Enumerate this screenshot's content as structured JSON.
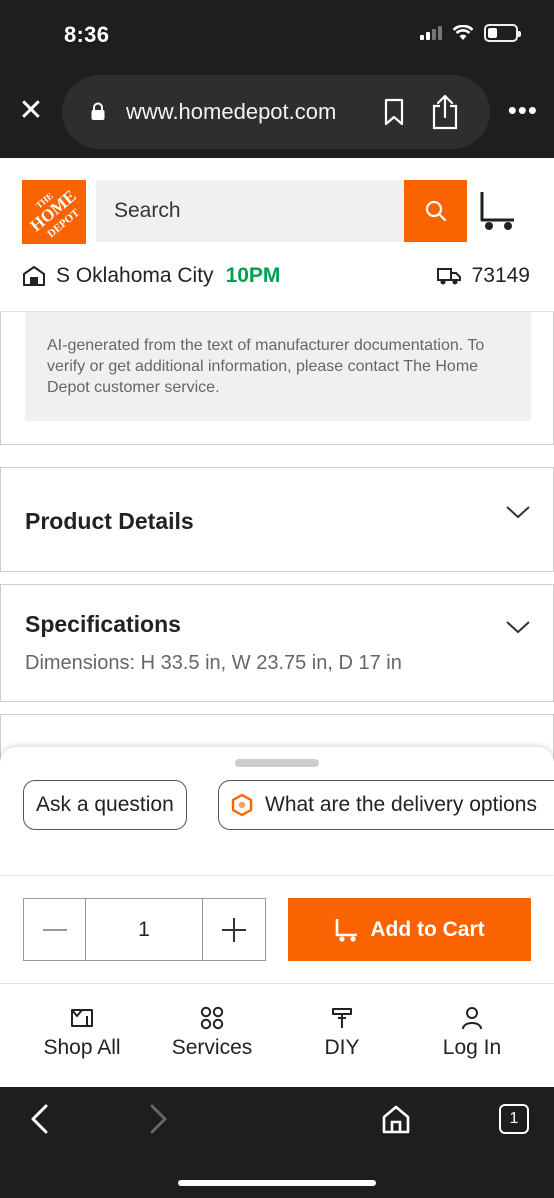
{
  "status_bar": {
    "time": "8:36"
  },
  "browser": {
    "url": "www.homedepot.com",
    "close_icon": "close-icon",
    "more_icon": "more-dots-icon",
    "tab_count": "1"
  },
  "header": {
    "logo_text": "THE HOME DEPOT",
    "search_placeholder": "Search",
    "store_name": "S Oklahoma City",
    "store_close_time": "10PM",
    "zip": "73149",
    "brand_color": "#f96302",
    "open_color": "#00a050"
  },
  "content": {
    "ai_disclaimer": "AI-generated from the text of manufacturer documentation. To verify or get additional information, please contact The Home Depot customer service.",
    "product_details_title": "Product Details",
    "specifications_title": "Specifications",
    "specifications_summary": "Dimensions: H 33.5 in, W 23.75 in, D 17 in"
  },
  "sheet": {
    "chip_ask": "Ask a question",
    "chip_delivery": "What are the delivery options"
  },
  "cart": {
    "quantity": "1",
    "add_label": "Add to Cart"
  },
  "bottom_nav": {
    "items": [
      {
        "label": "Shop All",
        "icon": "shop-all-icon"
      },
      {
        "label": "Services",
        "icon": "services-icon"
      },
      {
        "label": "DIY",
        "icon": "diy-icon"
      },
      {
        "label": "Log In",
        "icon": "user-icon"
      }
    ]
  }
}
